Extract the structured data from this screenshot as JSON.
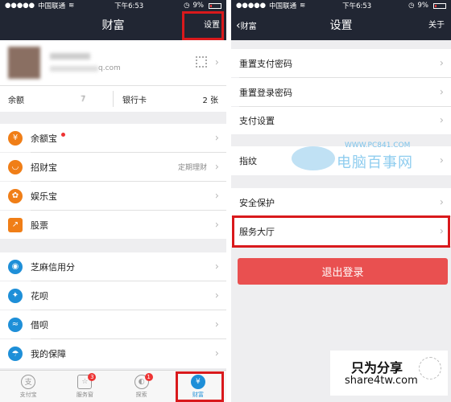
{
  "status": {
    "carrier": "中国联通",
    "time": "下午6:53",
    "battery": "9%"
  },
  "left": {
    "title": "财富",
    "settings_label": "设置",
    "account_suffix": "q.com",
    "balance_label": "余额",
    "balance_value": "7",
    "bankcard_label": "银行卡",
    "bankcard_value": "2 张",
    "menu1": [
      {
        "label": "余额宝",
        "icon": "yuebao-icon",
        "color": "#f07e17"
      },
      {
        "label": "招财宝",
        "icon": "zhaocaibao-icon",
        "color": "#f07e17",
        "right": "定期理财"
      },
      {
        "label": "娱乐宝",
        "icon": "yulebao-icon",
        "color": "#f07e17"
      },
      {
        "label": "股票",
        "icon": "stock-icon",
        "color": "#f07e17"
      }
    ],
    "menu2": [
      {
        "label": "芝麻信用分",
        "icon": "sesame-credit-icon",
        "color": "#1e8fd8"
      },
      {
        "label": "花呗",
        "icon": "huabei-icon",
        "color": "#1e8fd8"
      },
      {
        "label": "借呗",
        "icon": "jiebei-icon",
        "color": "#1e8fd8"
      },
      {
        "label": "我的保障",
        "icon": "insurance-icon",
        "color": "#1e8fd8"
      }
    ],
    "tabs": [
      {
        "label": "支付宝",
        "icon": "alipay-tab-icon"
      },
      {
        "label": "服务窗",
        "icon": "service-window-tab-icon",
        "badge": "3"
      },
      {
        "label": "探索",
        "icon": "explore-tab-icon",
        "badge": "1"
      },
      {
        "label": "财富",
        "icon": "wealth-tab-icon"
      }
    ]
  },
  "right": {
    "back_label": "财富",
    "title": "设置",
    "about_label": "关于",
    "group1": [
      "重置支付密码",
      "重置登录密码",
      "支付设置"
    ],
    "fingerprint": "指纹",
    "group2": [
      "安全保护",
      "服务大厅"
    ],
    "logout_label": "退出登录",
    "watermark_url": "WWW.PC841.COM",
    "watermark_name": "电脑百事网"
  },
  "brand": {
    "name": "只为分享",
    "url": "share4tw.com"
  },
  "colors": {
    "nav": "#212633",
    "accent_red": "#d9191c",
    "logout": "#e95050"
  }
}
